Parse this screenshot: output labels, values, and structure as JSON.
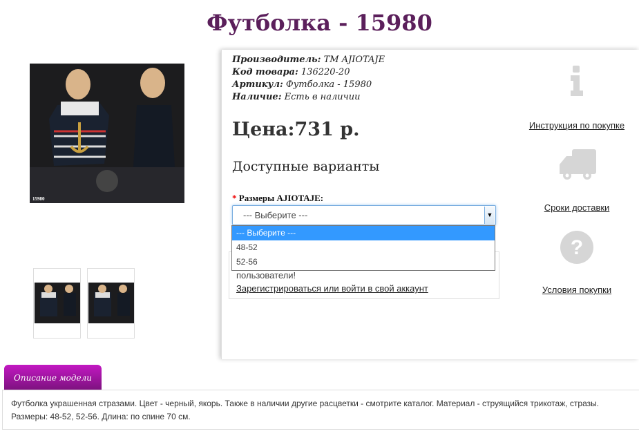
{
  "title": "Футболка - 15980",
  "image": {
    "code_label": "15980",
    "logo": "Ajiotaje"
  },
  "info": {
    "manufacturer_label": "Производитель:",
    "manufacturer": "ТМ AJIOTAJE",
    "code_label": "Код товара:",
    "code": "136220-20",
    "article_label": "Артикул:",
    "article": "Футболка - 15980",
    "availability_label": "Наличие:",
    "availability": "Есть в наличии"
  },
  "price": "Цена:731 р.",
  "variants_title": "Доступные варианты",
  "size": {
    "required_mark": "*",
    "label": "Размеры AJIOTAJE:",
    "selected": "--- Выберите ---",
    "options": [
      "--- Выберите ---",
      "48-52",
      "52-56"
    ]
  },
  "register": {
    "text": "пользователи!",
    "link": "Зарегистрироваться или войти в свой аккаунт"
  },
  "sidebar": [
    {
      "icon": "info-icon",
      "label": "Инструкция по покупке"
    },
    {
      "icon": "truck-icon",
      "label": "Сроки доставки"
    },
    {
      "icon": "question-icon",
      "label": "Условия покупки"
    }
  ],
  "description": {
    "tab": "Описание модели",
    "lines": [
      "Футболка украшенная стразами. Цвет - черный, якорь. Также в наличии другие расцветки - смотрите каталог. Материал - струящийся трикотаж, стразы.",
      "Размеры: 48-52, 52-56. Длина: по спине 70 см."
    ]
  },
  "colors": {
    "title": "#5b1f5b",
    "tab": "#a416a6",
    "highlight": "#3399ff"
  }
}
